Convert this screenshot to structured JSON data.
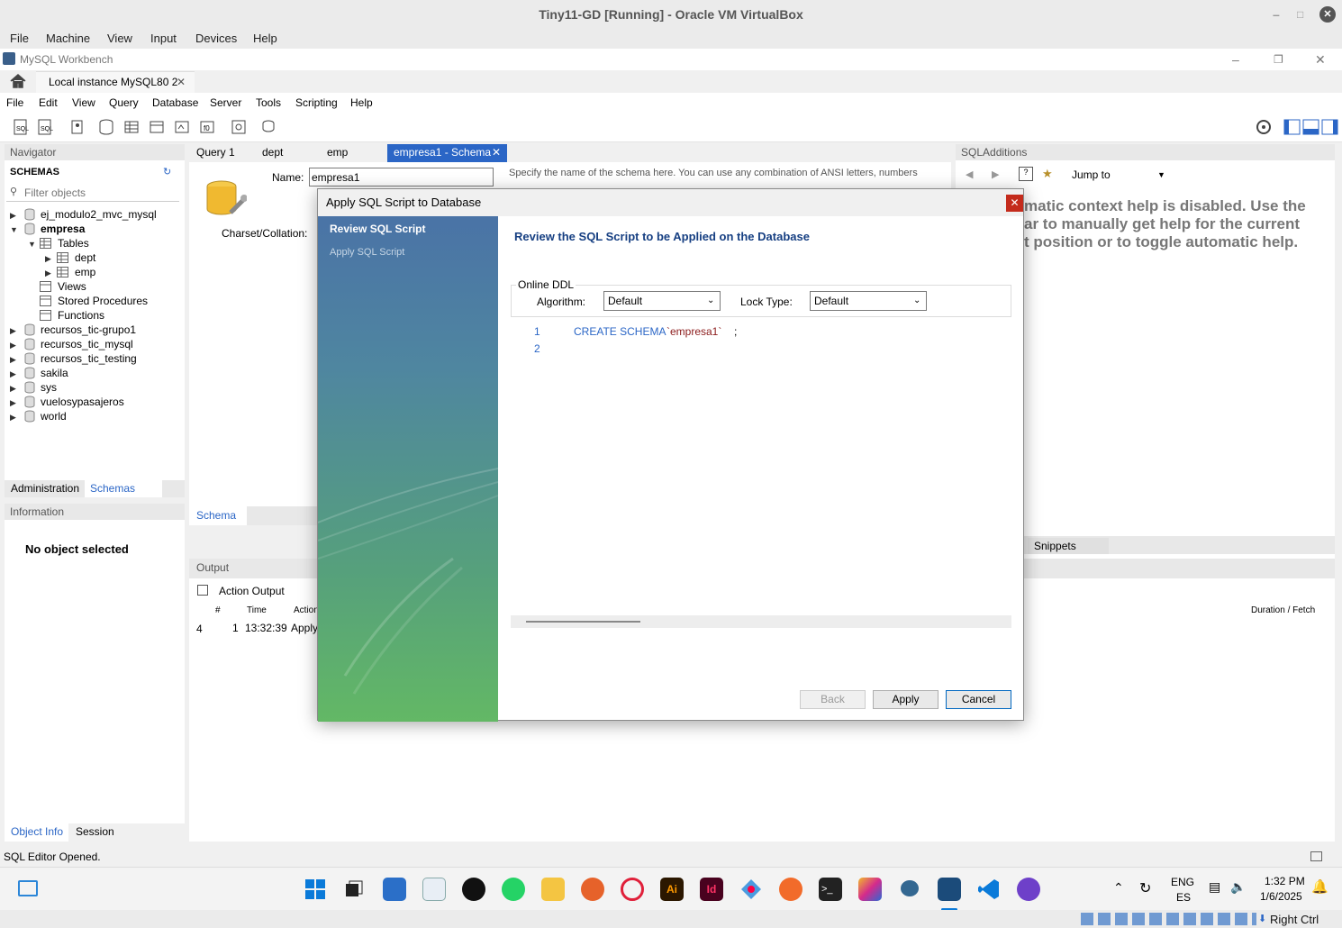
{
  "vbox": {
    "title": "Tiny11-GD [Running] - Oracle VM VirtualBox",
    "menu": [
      "File",
      "Machine",
      "View",
      "Input",
      "Devices",
      "Help"
    ],
    "status_right": "Right Ctrl"
  },
  "workbench": {
    "title": "MySQL Workbench",
    "connection_tab": "Local instance MySQL80 2",
    "menu": [
      "File",
      "Edit",
      "View",
      "Query",
      "Database",
      "Server",
      "Tools",
      "Scripting",
      "Help"
    ]
  },
  "navigator": {
    "title": "Navigator",
    "schemas_header": "SCHEMAS",
    "filter_placeholder": "Filter objects",
    "tree": {
      "s1": "ej_modulo2_mvc_mysql",
      "s2": "empresa",
      "tables": "Tables",
      "t1": "dept",
      "t2": "emp",
      "views": "Views",
      "procs": "Stored Procedures",
      "funcs": "Functions",
      "s3": "recursos_tic-grupo1",
      "s4": "recursos_tic_mysql",
      "s5": "recursos_tic_testing",
      "s6": "sakila",
      "s7": "sys",
      "s8": "vuelosypasajeros",
      "s9": "world"
    },
    "tab_admin": "Administration",
    "tab_schemas": "Schemas",
    "info_title": "Information",
    "no_object": "No object selected",
    "tab_object_info": "Object Info",
    "tab_session": "Session"
  },
  "editor": {
    "tabs": [
      "Query 1",
      "dept",
      "emp",
      "empresa1 - Schema"
    ],
    "name_label": "Name:",
    "name_value": "empresa1",
    "name_hint": "Specify the name of the schema here. You can use any combination of ANSI letters, numbers",
    "charset_label": "Charset/Collation:",
    "bottom_tab": "Schema"
  },
  "sql_additions": {
    "title": "SQLAdditions",
    "jump_to": "Jump to",
    "help_text": "matic context help is disabled. Use the ar to manually get help for the current t position or to toggle automatic help.",
    "help_l1": "matic context help is disabled. Use the",
    "help_l2": "ar to manually get help for the current",
    "help_l3": "t position or to toggle automatic help.",
    "snippets": "Snippets"
  },
  "output": {
    "title": "Output",
    "action_output": "Action Output",
    "headers": {
      "num": "#",
      "time": "Time",
      "action": "Action",
      "duration": "Duration / Fetch"
    },
    "row": {
      "icon_num": "4",
      "num": "1",
      "time": "13:32:39",
      "action": "Apply c"
    }
  },
  "dialog": {
    "title": "Apply SQL Script to Database",
    "steps": [
      "Review SQL Script",
      "Apply SQL Script"
    ],
    "heading": "Review the SQL Script to be Applied on the Database",
    "online_ddl": "Online DDL",
    "algorithm_label": "Algorithm:",
    "algorithm_value": "Default",
    "lock_label": "Lock Type:",
    "lock_value": "Default",
    "code": {
      "line1_num": "1",
      "line2_num": "2",
      "kw": "CREATE SCHEMA",
      "ident": "`empresa1`",
      "end": ";"
    },
    "btn_back": "Back",
    "btn_apply": "Apply",
    "btn_cancel": "Cancel"
  },
  "statusbar": "SQL Editor Opened.",
  "taskbar": {
    "lang": "ENG",
    "region": "ES",
    "time": "1:32 PM",
    "date": "1/6/2025"
  }
}
